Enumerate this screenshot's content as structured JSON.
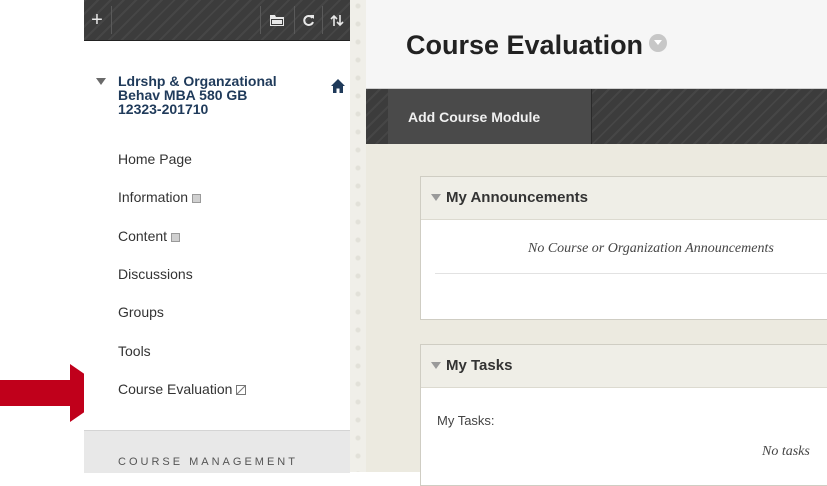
{
  "toolbar": {
    "add_label": "+",
    "folder_icon": "folder-icon",
    "refresh_icon": "refresh-icon",
    "sort_icon": "sort-icon"
  },
  "course": {
    "title": "Ldrshp & Organzational\nBehav MBA 580 GB\n12323-201710",
    "home_icon": "home-icon"
  },
  "menu": {
    "items": [
      {
        "label": "Home Page",
        "icon": ""
      },
      {
        "label": "Information",
        "icon": "square-icon"
      },
      {
        "label": "Content",
        "icon": "square-icon"
      },
      {
        "label": "Discussions",
        "icon": ""
      },
      {
        "label": "Groups",
        "icon": ""
      },
      {
        "label": "Tools",
        "icon": ""
      },
      {
        "label": "Course Evaluation",
        "icon": "hidden-square-icon"
      }
    ],
    "management_label": "COURSE MANAGEMENT"
  },
  "main": {
    "page_title": "Course Evaluation",
    "action_button": "Add Course Module",
    "modules": [
      {
        "title": "My Announcements",
        "message": "No Course or Organization Announcements"
      },
      {
        "title": "My Tasks",
        "label": "My Tasks:",
        "message": "No tasks"
      }
    ]
  },
  "colors": {
    "arrow": "#c0001b",
    "dark_bar": "#3c3c3c",
    "course_title": "#1f3a5a"
  }
}
